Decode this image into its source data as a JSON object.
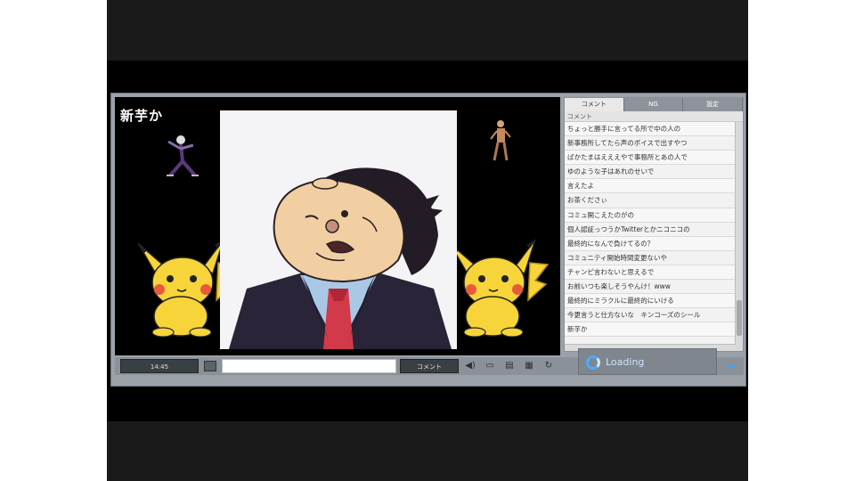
{
  "video": {
    "title": "新芋か"
  },
  "side_panel": {
    "tabs": [
      "コメント",
      "NG",
      "設定"
    ],
    "list_header": "コメント",
    "comments": [
      "ちょっと勝手に言ってる所で中の人の",
      "新事務所してたら声のボイスで出すやつ",
      "ばかたまはえええやで事務所とあの人で",
      "ゆのような子はあれのせいで",
      "言えたよ",
      "お茶くださぃ",
      "コミュ開こえたのがの",
      "個人認証っつうかTwitterとかニコニコの",
      "最終的になんで負けてるの？",
      "コミュニティ開始時間変更ないや",
      "チャンピ言わないと思えるで",
      "お前いつも楽しそうやんけ！www",
      "最終的にミラクルに最終的にいける",
      "今更言うと仕方ないな　キンコーズのシール",
      "新芋か"
    ]
  },
  "controls": {
    "time": "14:45",
    "comment_placeholder": "",
    "comment_button": "コメント"
  },
  "overlay": {
    "loading_text": "Loading"
  },
  "colors": {
    "player_frame": "#9aa1a8",
    "accent_blue": "#4fa9ff",
    "pikachu_yellow": "#f7d43a"
  }
}
